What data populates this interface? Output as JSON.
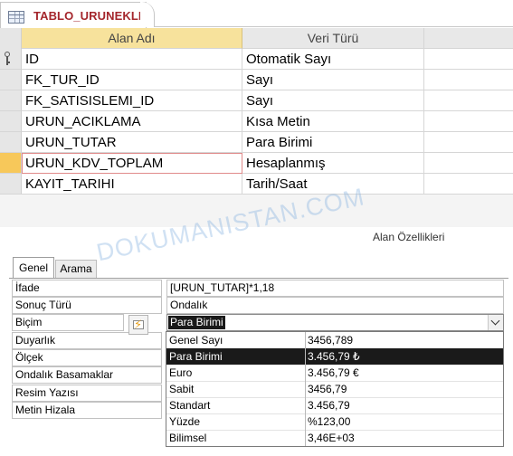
{
  "document_tab": {
    "title": "TABLO_URUNEKLE",
    "icon": "table-icon"
  },
  "grid": {
    "headers": {
      "field_name": "Alan Adı",
      "data_type": "Veri Türü"
    },
    "rows": [
      {
        "name": "ID",
        "type": "Otomatik Sayı",
        "primary_key": true
      },
      {
        "name": "FK_TUR_ID",
        "type": "Sayı"
      },
      {
        "name": "FK_SATISISLEMI_ID",
        "type": "Sayı"
      },
      {
        "name": "URUN_ACIKLAMA",
        "type": "Kısa Metin"
      },
      {
        "name": "URUN_TUTAR",
        "type": "Para Birimi"
      },
      {
        "name": "URUN_KDV_TOPLAM",
        "type": "Hesaplanmış",
        "current": true
      },
      {
        "name": "KAYIT_TARIHI",
        "type": "Tarih/Saat"
      }
    ]
  },
  "watermark": "DOKUMANISTAN.COM",
  "field_properties": {
    "title": "Alan Özellikleri",
    "tabs": {
      "general": "Genel",
      "lookup": "Arama"
    },
    "rows": [
      {
        "label": "İfade",
        "value": "[URUN_TUTAR]*1,18"
      },
      {
        "label": "Sonuç Türü",
        "value": "Ondalık"
      },
      {
        "label": "Biçim",
        "value": "Para Birimi"
      },
      {
        "label": "Duyarlık",
        "value": ""
      },
      {
        "label": "Ölçek",
        "value": ""
      },
      {
        "label": "Ondalık Basamaklar",
        "value": ""
      },
      {
        "label": "Resim Yazısı",
        "value": ""
      },
      {
        "label": "Metin Hizala",
        "value": ""
      }
    ]
  },
  "format_dropdown": {
    "selected": "Para Birimi",
    "options": [
      {
        "name": "Genel Sayı",
        "example": "3456,789"
      },
      {
        "name": "Para Birimi",
        "example": "3.456,79 ₺"
      },
      {
        "name": "Euro",
        "example": "3.456,79 €"
      },
      {
        "name": "Sabit",
        "example": "3456,79"
      },
      {
        "name": "Standart",
        "example": "3.456,79"
      },
      {
        "name": "Yüzde",
        "example": "%123,00"
      },
      {
        "name": "Bilimsel",
        "example": "3,46E+03"
      }
    ]
  },
  "colors": {
    "header_accent": "#f7e29c",
    "row_selector_active": "#f7c85a",
    "title_red": "#a4262c",
    "selection": "#1a1a1a"
  }
}
